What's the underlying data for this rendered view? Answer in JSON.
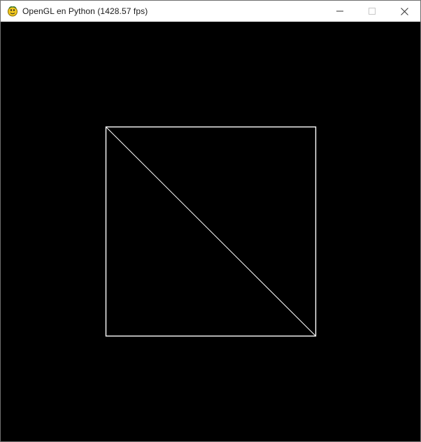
{
  "window": {
    "title": "OpenGL en Python (1428.57 fps)",
    "app_icon": "pygame-snake-icon",
    "controls": {
      "minimize": "minimize-icon",
      "maximize": "maximize-icon",
      "close": "close-icon"
    }
  },
  "scene": {
    "background_color": "#000000",
    "line_color": "#ffffff",
    "shape": "square wireframe with diagonal (two triangles)"
  }
}
